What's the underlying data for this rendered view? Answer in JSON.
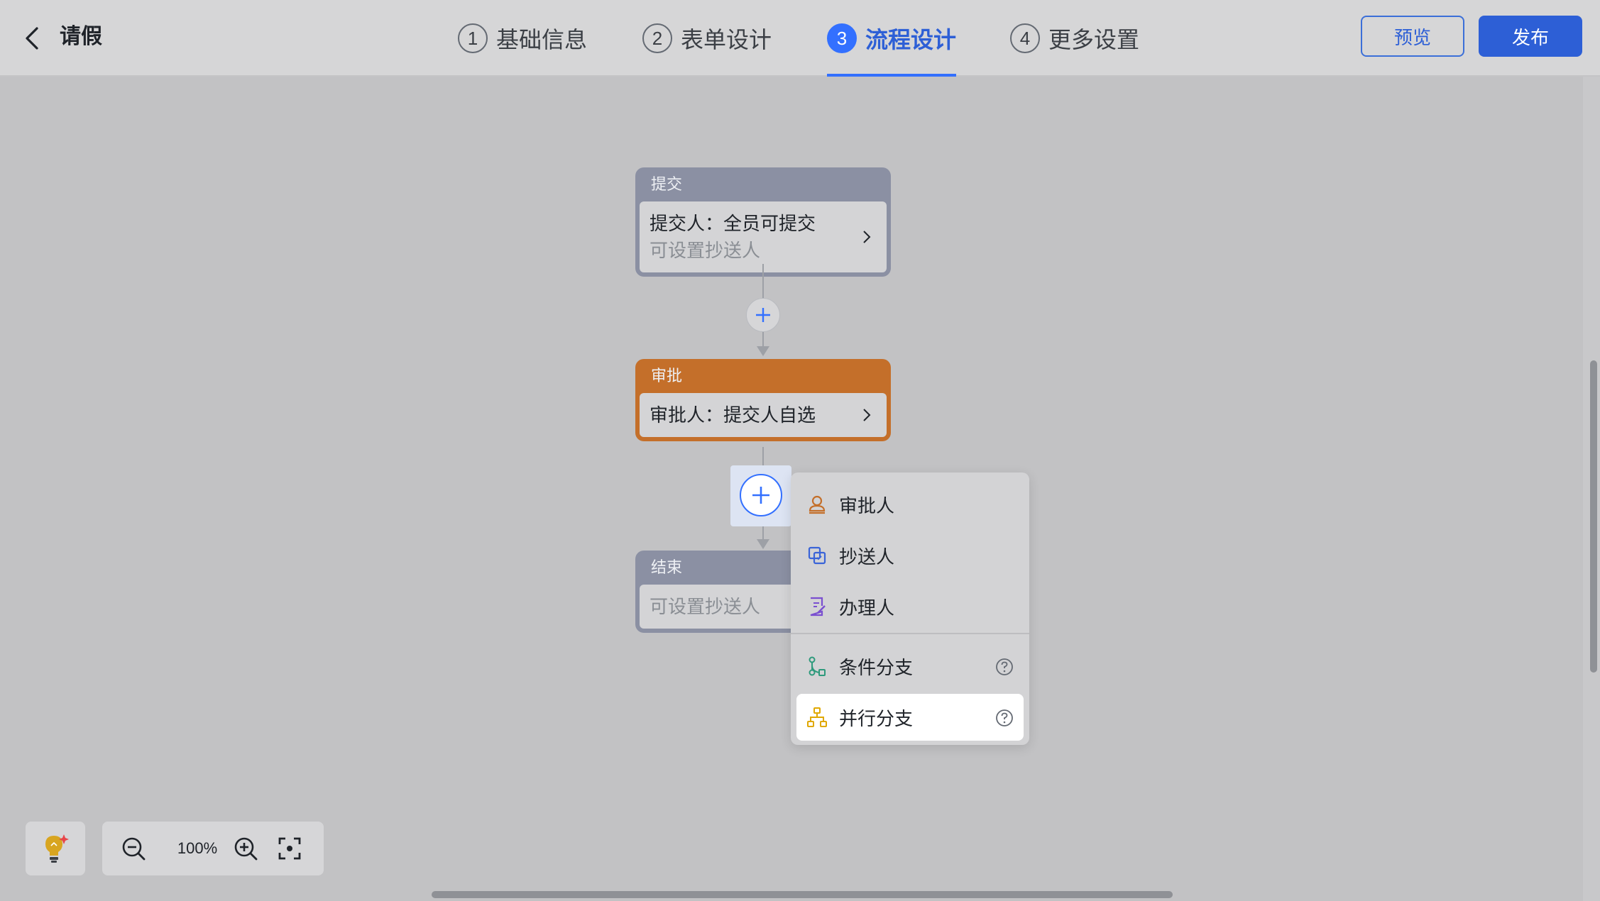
{
  "header": {
    "title": "请假",
    "steps": [
      {
        "num": "1",
        "label": "基础信息"
      },
      {
        "num": "2",
        "label": "表单设计"
      },
      {
        "num": "3",
        "label": "流程设计"
      },
      {
        "num": "4",
        "label": "更多设置"
      }
    ],
    "active_step": 3,
    "preview_label": "预览",
    "publish_label": "发布"
  },
  "flow": {
    "submit": {
      "title": "提交",
      "line1": "提交人：全员可提交",
      "line2": "可设置抄送人"
    },
    "approve": {
      "title": "审批",
      "line1": "审批人：提交人自选"
    },
    "end": {
      "title": "结束",
      "line2": "可设置抄送人"
    }
  },
  "add_menu": {
    "items": [
      {
        "label": "审批人",
        "icon": "approver-icon",
        "color": "#c46f2a"
      },
      {
        "label": "抄送人",
        "icon": "cc-icon",
        "color": "#3a64d8"
      },
      {
        "label": "办理人",
        "icon": "handler-icon",
        "color": "#7a4fd0"
      },
      {
        "label": "条件分支",
        "icon": "condition-branch-icon",
        "color": "#2e9a7c"
      },
      {
        "label": "并行分支",
        "icon": "parallel-branch-icon",
        "color": "#e0a800"
      }
    ],
    "selected_index": 4
  },
  "zoom": {
    "level": "100%"
  },
  "colors": {
    "accent": "#3370ff",
    "approve_node": "#c46f2a",
    "default_node": "#8b90a3"
  }
}
